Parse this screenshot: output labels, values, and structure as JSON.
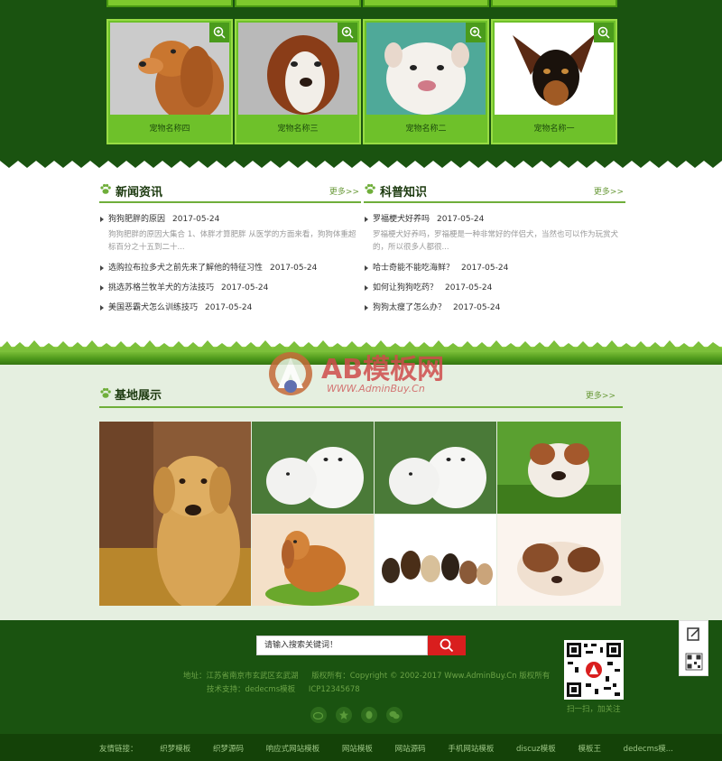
{
  "pets": [
    {
      "name": "宠物名称四",
      "bg": "#c9c9c9"
    },
    {
      "name": "宠物名称三",
      "bg": "#b7b7b7"
    },
    {
      "name": "宠物名称二",
      "bg": "#4fa999"
    },
    {
      "name": "宠物名称一",
      "bg": "#ffffff"
    }
  ],
  "news": {
    "title": "新闻资讯",
    "more": "更多>>",
    "items": [
      {
        "title": "狗狗肥胖的原因",
        "date": "2017-05-24",
        "summary": "狗狗肥胖的原因大集合 1、体胖才算肥胖 从医学的方面来看，狗狗体重超标百分之十五到二十..."
      },
      {
        "title": "选购拉布拉多犬之前先来了解他的特征习性",
        "date": "2017-05-24"
      },
      {
        "title": "挑选苏格兰牧羊犬的方法技巧",
        "date": "2017-05-24"
      },
      {
        "title": "美国恶霸犬怎么训练技巧",
        "date": "2017-05-24"
      }
    ]
  },
  "science": {
    "title": "科普知识",
    "more": "更多>>",
    "items": [
      {
        "title": "罗福梗犬好养吗",
        "date": "2017-05-24",
        "summary": "罗福梗犬好养吗，罗福梗是一种非常好的伴侣犬，当然也可以作为玩赏犬的，所以很多人都很..."
      },
      {
        "title": "哈士奇能不能吃海鲜？",
        "date": "2017-05-24"
      },
      {
        "title": "如何让狗狗吃药？",
        "date": "2017-05-24"
      },
      {
        "title": "狗狗太瘦了怎么办？",
        "date": "2017-05-24"
      }
    ]
  },
  "base": {
    "title": "基地展示",
    "more": "更多>>"
  },
  "watermark": {
    "brand": "AB模板网",
    "url": "WWW.AdminBuy.Cn"
  },
  "footer": {
    "search_placeholder": "请输入搜索关键词！",
    "address": "地址：江苏省南京市玄武区玄武湖",
    "copyright": "版权所有：Copyright © 2002-2017 Www.AdminBuy.Cn 版权所有",
    "support": "技术支持：dedecms模板",
    "icp": "ICP12345678",
    "qr_caption": "扫一扫，加关注",
    "links_label": "友情链接：",
    "links": [
      "织梦模板",
      "织梦源码",
      "响应式网站模板",
      "网站模板",
      "网站源码",
      "手机网站模板",
      "discuz模板",
      "模板王",
      "dedecms模..."
    ]
  },
  "colors": {
    "dark_green": "#1a5310",
    "bright_green": "#6ec12a",
    "search_red": "#d91e1e"
  }
}
